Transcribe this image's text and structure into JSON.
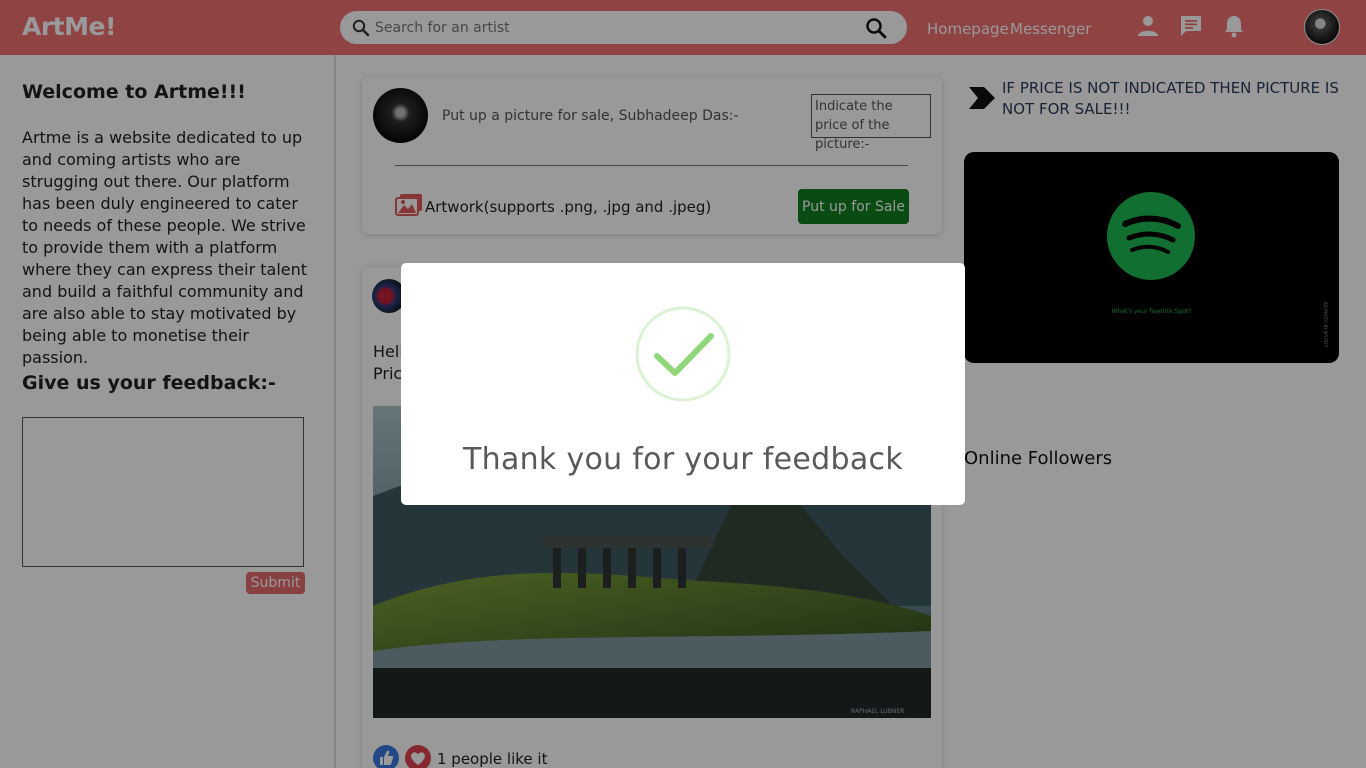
{
  "header": {
    "logo": "ArtMe!",
    "search_placeholder": "Search for an artist",
    "nav": {
      "homepage": "Homepage",
      "messenger": "Messenger"
    },
    "icons": [
      "search-icon",
      "person-icon",
      "chat-icon",
      "bell-icon"
    ],
    "background_color": "#ef7070"
  },
  "left": {
    "welcome_title": "Welcome to Artme!!!",
    "welcome_text": "Artme is a website dedicated to up and coming artists who are strugging out there. Our platform has been duly engineered to cater to needs of these people. We strive to provide them with a platform where they can express their talent and build a faithful community and are also able to stay motivated by being able to monetise their passion.",
    "feedback_title": "Give us your feedback:-",
    "feedback_value": "",
    "submit_label": "Submit"
  },
  "composer": {
    "prompt": "Put up a picture for sale, Subhadeep Das:-",
    "price_placeholder": "Indicate the price of the picture:-",
    "artwork_label": "Artwork(supports .png, .jpg and .jpeg)",
    "sale_button": "Put up for Sale",
    "sale_button_color": "#0f7d1f"
  },
  "feed_post": {
    "text_line1": "Hell",
    "text_line2": "Pric",
    "likes_text": "1 people like it",
    "image_watermark": "RAPHAEL LUBNER"
  },
  "right": {
    "notice": "IF PRICE IS NOT INDICATED THEN PICTURE IS NOT FOR SALE!!!",
    "ad_caption": "What's your favorite Spot?",
    "ad_side_text": "AD PHOTO BY SPOTIFY",
    "online_title": "Online Followers"
  },
  "modal": {
    "title": "Thank you for your feedback",
    "icon": "check-circle-icon",
    "check_color": "#8fd77a"
  }
}
